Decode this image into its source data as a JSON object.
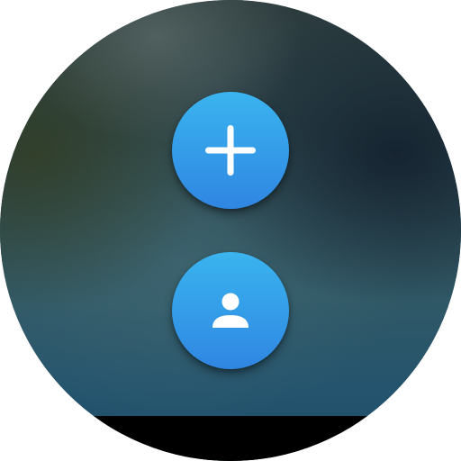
{
  "screen": {
    "shape": "round",
    "background_colors": [
      "#2b3a3c",
      "#305866",
      "#1f4c66"
    ]
  },
  "actions": [
    {
      "id": "add",
      "icon": "plus-icon",
      "color": "#2f86e2"
    },
    {
      "id": "contact",
      "icon": "person-icon",
      "color": "#2f86e2"
    }
  ],
  "colors": {
    "accent_top": "#3ab4ef",
    "accent_bottom": "#2f86e2",
    "icon": "#ffffff"
  }
}
